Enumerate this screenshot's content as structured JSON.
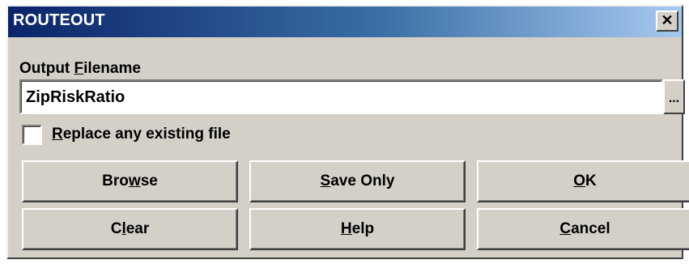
{
  "window": {
    "title": "ROUTEOUT",
    "close_glyph": "✕"
  },
  "output": {
    "label_prefix": "Output ",
    "label_accel": "F",
    "label_suffix": "ilename",
    "value": "ZipRiskRatio",
    "ellipsis": "..."
  },
  "replace": {
    "label_accel": "R",
    "label_rest": "eplace any existing file",
    "checked": false
  },
  "buttons": {
    "browse": {
      "pre": "Bro",
      "accel": "w",
      "post": "se"
    },
    "save_only": {
      "pre": "",
      "accel": "S",
      "post": "ave Only"
    },
    "ok": {
      "pre": "",
      "accel": "O",
      "post": "K"
    },
    "clear": {
      "pre": "C",
      "accel": "l",
      "post": "ear"
    },
    "help": {
      "pre": "",
      "accel": "H",
      "post": "elp"
    },
    "cancel": {
      "pre": "",
      "accel": "C",
      "post": "ancel"
    }
  },
  "colors": {
    "face": "#d4d0c8",
    "title_start": "#0a246a",
    "title_end": "#a6caf0"
  }
}
